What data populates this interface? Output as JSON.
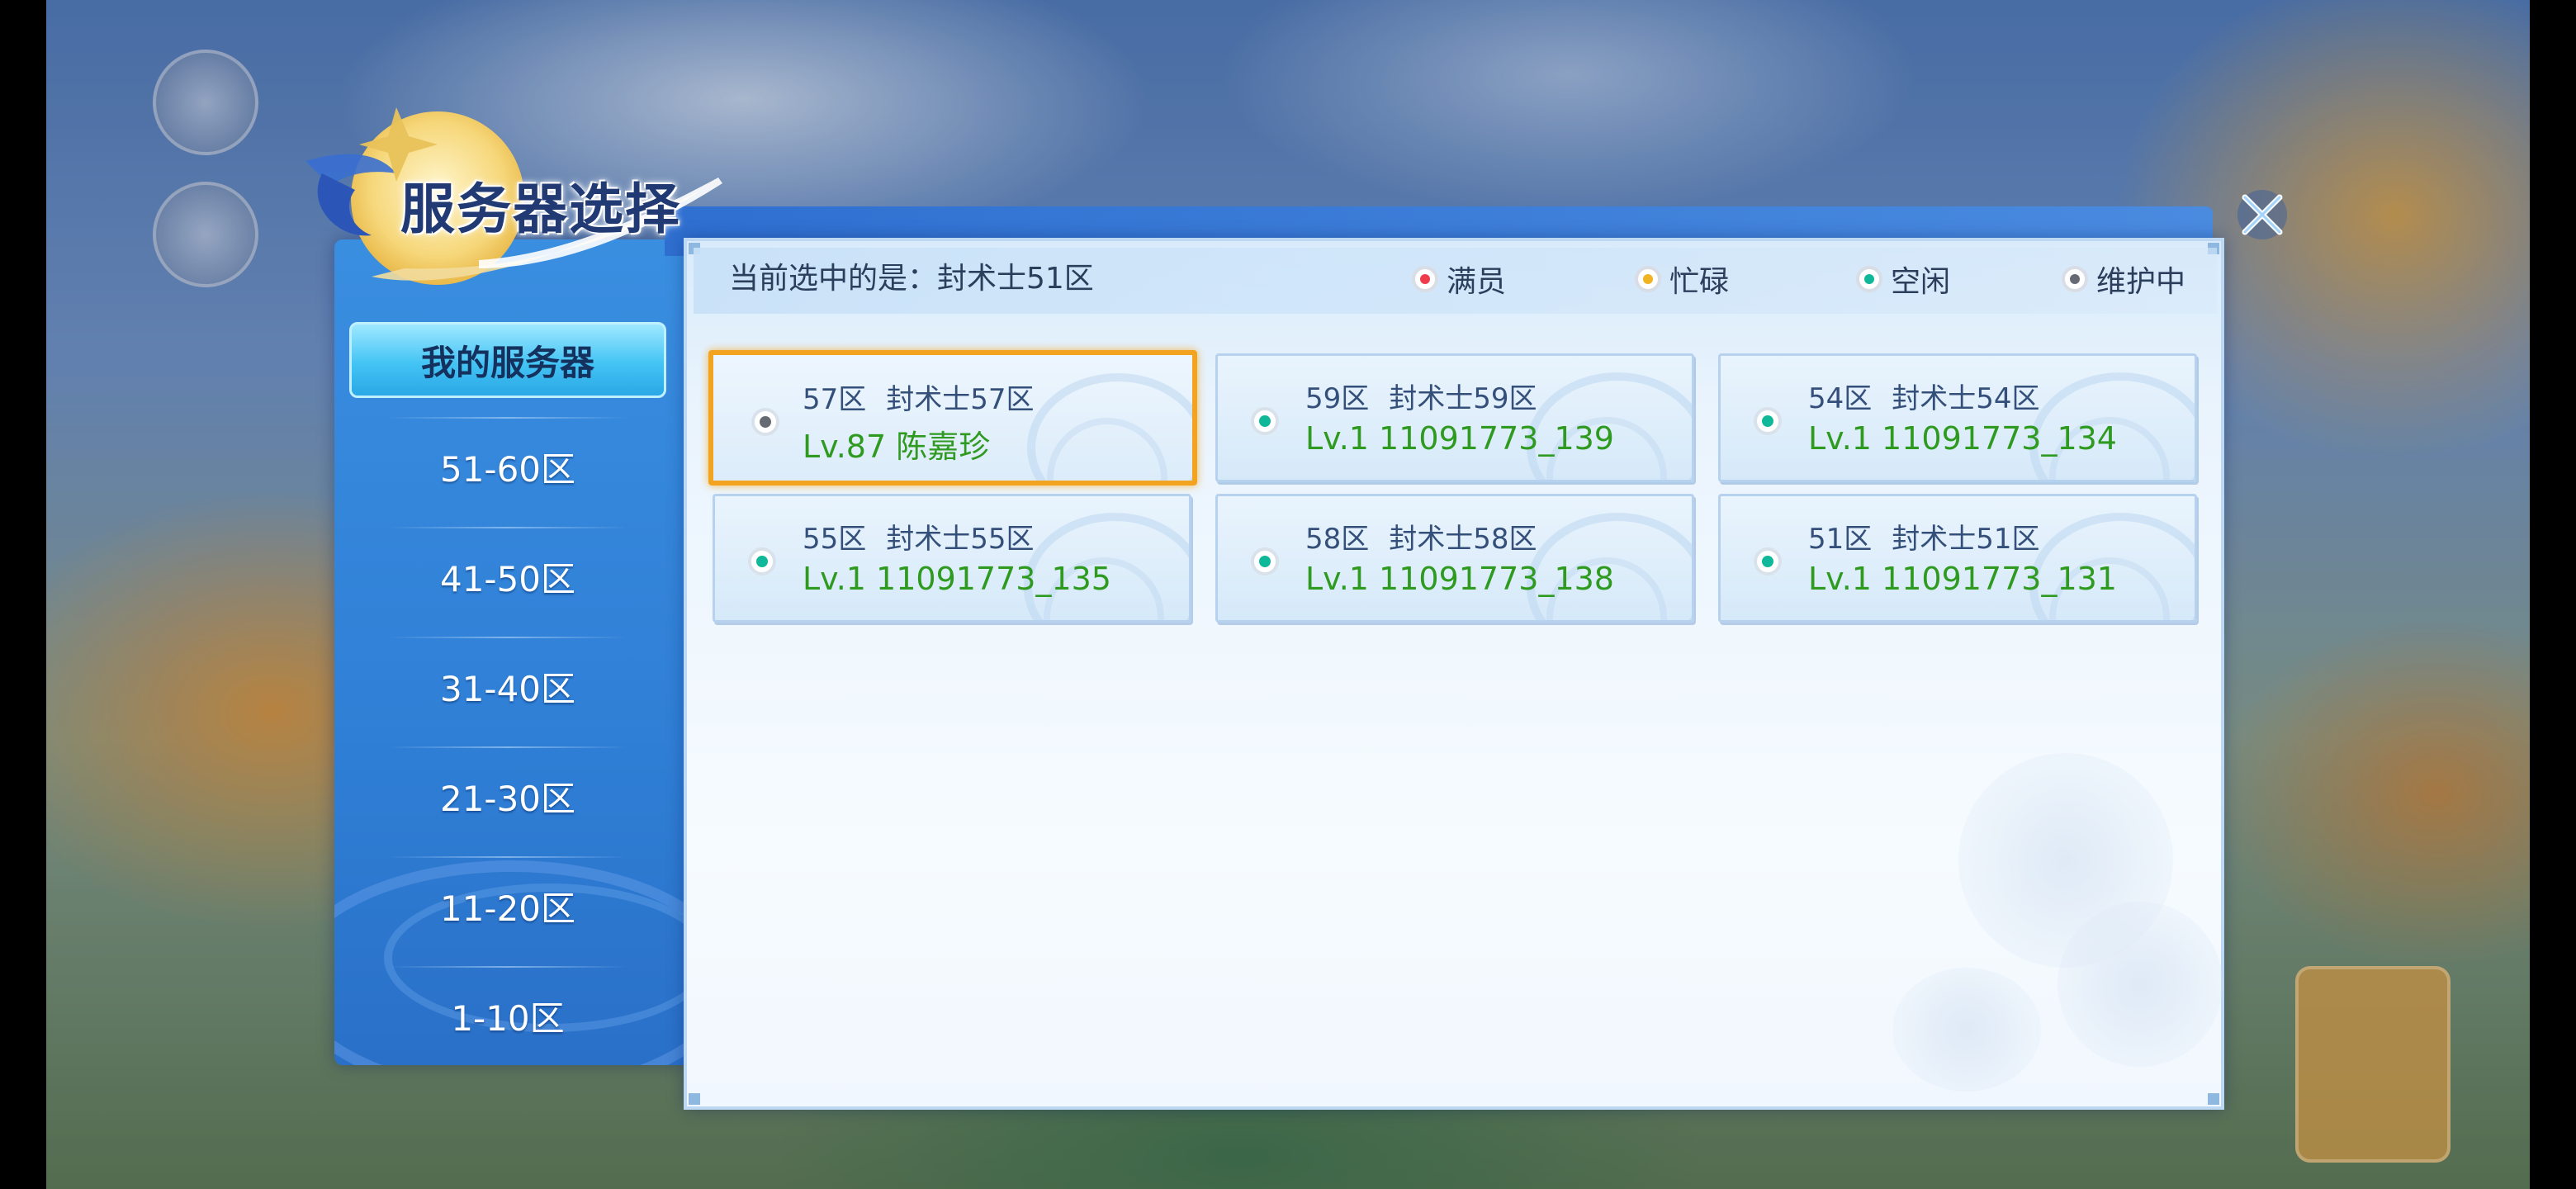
{
  "dialog": {
    "title": "服务器选择",
    "current_label": "当前选中的是：封术士51区"
  },
  "legend": [
    {
      "label": "满员",
      "color": "#ee3c4c"
    },
    {
      "label": "忙碌",
      "color": "#f0b323"
    },
    {
      "label": "空闲",
      "color": "#10b89a"
    },
    {
      "label": "维护中",
      "color": "#666b73"
    }
  ],
  "tabs": {
    "my_servers": "我的服务器",
    "ranges": [
      "51-60区",
      "41-50区",
      "31-40区",
      "21-30区",
      "11-20区",
      "1-10区"
    ]
  },
  "servers": [
    {
      "zone": "57区",
      "name": "封术士57区",
      "character": "Lv.87 陈嘉珍",
      "status": "maintenance",
      "status_color": "#666b73",
      "selected": true
    },
    {
      "zone": "59区",
      "name": "封术士59区",
      "character": "Lv.1 11091773_139",
      "status": "idle",
      "status_color": "#10b89a",
      "selected": false
    },
    {
      "zone": "54区",
      "name": "封术士54区",
      "character": "Lv.1 11091773_134",
      "status": "idle",
      "status_color": "#10b89a",
      "selected": false
    },
    {
      "zone": "55区",
      "name": "封术士55区",
      "character": "Lv.1 11091773_135",
      "status": "idle",
      "status_color": "#10b89a",
      "selected": false
    },
    {
      "zone": "58区",
      "name": "封术士58区",
      "character": "Lv.1 11091773_138",
      "status": "idle",
      "status_color": "#10b89a",
      "selected": false
    },
    {
      "zone": "51区",
      "name": "封术士51区",
      "character": "Lv.1 11091773_131",
      "status": "idle",
      "status_color": "#10b89a",
      "selected": false
    }
  ],
  "icons": {
    "close": "close-icon",
    "status": "status-dot-icon"
  }
}
